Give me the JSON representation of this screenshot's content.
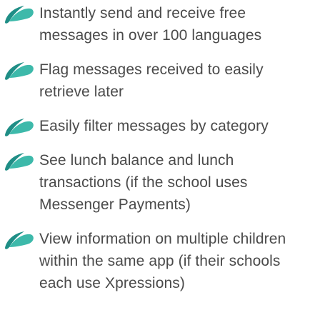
{
  "features": [
    {
      "text": "Instantly send and receive free messages in over 100 languages",
      "icon": "swoosh-icon"
    },
    {
      "text": "Flag messages received to easily retrieve later",
      "icon": "swoosh-icon"
    },
    {
      "text": "Easily filter messages by category",
      "icon": "swoosh-icon"
    },
    {
      "text": "See lunch balance and lunch transactions (if the school uses Messenger Payments)",
      "icon": "swoosh-icon"
    },
    {
      "text": "View information on multiple children within the same app (if their schools each use Xpressions)",
      "icon": "swoosh-icon"
    }
  ],
  "colors": {
    "icon_dark": "#1f8e86",
    "icon_light": "#3db9aa",
    "text": "#4a4a4a",
    "background": "#ffffff"
  }
}
